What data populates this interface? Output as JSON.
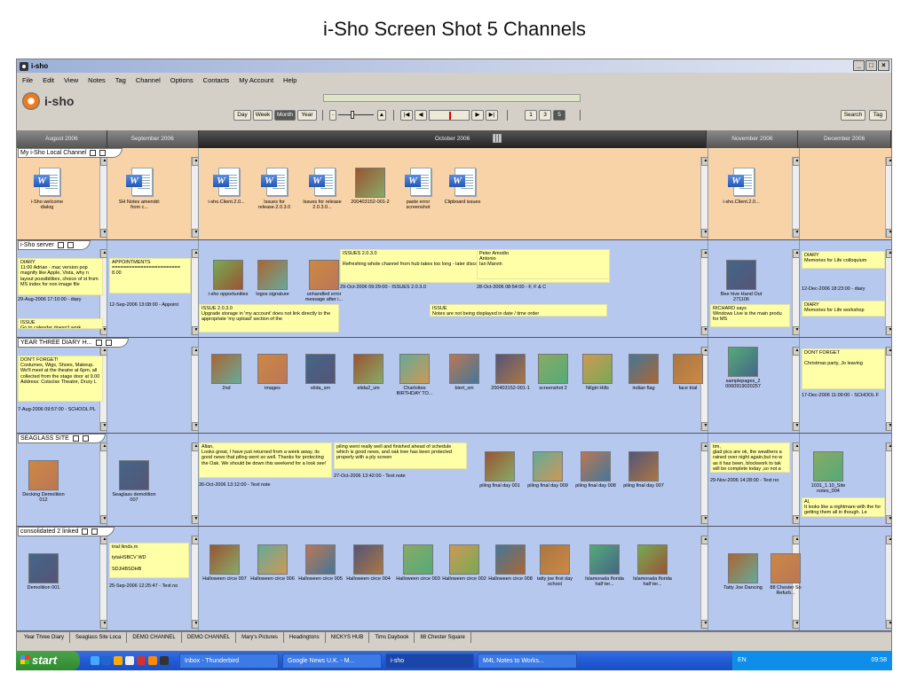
{
  "slide_title": "i-Sho Screen Shot 5 Channels",
  "window": {
    "title": "i-sho",
    "buttons": [
      "_",
      " ",
      "X"
    ]
  },
  "menu": [
    "File",
    "Edit",
    "View",
    "Notes",
    "Tag",
    "Channel",
    "Options",
    "Contacts",
    "My Account",
    "Help"
  ],
  "logo": "i-sho",
  "toolbar": {
    "views": [
      "Day",
      "Week",
      "Month",
      "Year"
    ],
    "nav": [
      "|◀",
      "◀",
      "▶",
      "▶|"
    ],
    "counts": [
      "1",
      "3",
      "5"
    ],
    "search": "Search",
    "tag": "Tag"
  },
  "months": [
    "August 2006",
    "September 2006",
    "October 2006",
    "November 2006",
    "December 2006"
  ],
  "channels": [
    {
      "name": "My i-Sho Local Channel",
      "items": [
        {
          "label": "i-Sho welcome dialog",
          "col": 0,
          "kind": "doc"
        },
        {
          "label": "SH Notes amendd: from c...",
          "col": 1,
          "kind": "doc"
        },
        {
          "label": "i-sho.Client.2.0...",
          "col": 2,
          "kind": "txt"
        },
        {
          "label": "Issues for release.2.0.3.0",
          "col": 2,
          "kind": "doc"
        },
        {
          "label": "Issues for release 2.0.3.0...",
          "col": 2,
          "kind": "doc"
        },
        {
          "label": "200403152-001-2",
          "col": 2,
          "kind": "photo"
        },
        {
          "label": "paste error screenshot",
          "col": 2,
          "kind": "doc"
        },
        {
          "label": "Clipboard issues",
          "col": 2,
          "kind": "doc"
        },
        {
          "label": "i-sho.Client.2.0...",
          "col": 3,
          "kind": "txt"
        }
      ]
    },
    {
      "name": "i-Sho server",
      "notes": [
        {
          "text": "DIARY\n11:00 Adrian - mac version pop magnify like Apple, Vista, why n layout possibilities, choice of st from MS index for non image file",
          "meta": "29-Aug-2006 17:10:00 - diary"
        },
        {
          "text": "ISSUE\nGo to calendar doesn't work",
          "meta": ""
        },
        {
          "text": "APPOINTMENTS\n========================\n8.00",
          "meta": "12-Sep-2006 13:08:00 - Appoint"
        },
        {
          "text": "ISSUES 2.0.3.0\n\nRefreshing whole channel from hub takes too long - later discovered this could be due to compress files not being set",
          "meta": "29-Oct-2006 09:29:00 - ISSUES 2.0.3.0"
        },
        {
          "text": "Peter Amodio\nAntonio\nIan Marvin",
          "meta": "28-Oct-2006 08:54:00 - F, F & C"
        },
        {
          "text": "ISSUE 2.0.3.0\nUpgrade storage in 'my account' does not link directly to the appropriate 'my upload' section of the",
          "meta": ""
        },
        {
          "text": "ISSUE\nNotes are not being displayed in date / time order",
          "meta": ""
        },
        {
          "text": "RICHARD says\nWindows Live is the main produ for MS",
          "meta": ""
        },
        {
          "text": "DIARY\nMemories for Life colloquium",
          "meta": "12-Dec-2006 18:23:00 - diary"
        },
        {
          "text": "DIARY\nMemories for Life workshop",
          "meta": ""
        }
      ],
      "items": [
        {
          "label": "i-sho opportunities"
        },
        {
          "label": "logos signature"
        },
        {
          "label": "unhandled error message after i..."
        },
        {
          "label": "Bee hive Hand Out 271106"
        }
      ]
    },
    {
      "name": "YEAR THREE DIARY H...",
      "notes": [
        {
          "text": "DON'T FORGET!\nCostumes, Wigs, Shoes, Makeup. We'll meet at the theatre at 6pm, all collected from the stage door at 9.00 Address: Cotsclse Theatre, Drury L",
          "meta": "7-Aug-2006 09:57:00 - SCHOOL PL"
        },
        {
          "text": "DONT FORGET\n\nChristmas party, Jo leaving",
          "meta": "17-Dec-2006 11:09:00 - SCHOOL F"
        }
      ],
      "items": [
        {
          "label": "2nd"
        },
        {
          "label": "images"
        },
        {
          "label": "elida_sm"
        },
        {
          "label": "elida2_sm"
        },
        {
          "label": "Charlottes BIRTHDAY TO..."
        },
        {
          "label": "blert_sm"
        },
        {
          "label": "200403152-001-1"
        },
        {
          "label": "screenshot 2"
        },
        {
          "label": "Nilgiri Hills"
        },
        {
          "label": "indian flag"
        },
        {
          "label": "face trial"
        },
        {
          "label": "samplepages_2 0060919020257"
        }
      ]
    },
    {
      "name": "SEAGLASS SITE",
      "notes": [
        {
          "text": "Allan,\nLooks great, I have just returned from a week away, its good news that piling went so well. Thanks for protecting the Oak. We should be down this weekend for a look see!",
          "meta": "30-Oct-2006 13:12:00 - Text note"
        },
        {
          "text": "piling went really well and finished ahead of schedule which is good news, and oak tree has been protected properly with a ply screen",
          "meta": "27-Oct-2006 13:42:00 - Text note"
        },
        {
          "text": "tim,\nglad pics are ok, the weathers a rained over night again,but no w as it has been, blockwork to tak will be complete today ,so not a",
          "meta": "29-Nov-2006 14:28:00 - Text no"
        },
        {
          "text": "Al,\nIt looks like a nightmare with the for getting them all in though. Le",
          "meta": ""
        }
      ],
      "items": [
        {
          "label": "Decking Demolition 012"
        },
        {
          "label": "Seaglass demolition 007"
        },
        {
          "label": "piling final day 001"
        },
        {
          "label": "piling final day 009"
        },
        {
          "label": "piling final day 008"
        },
        {
          "label": "piling final day 007"
        },
        {
          "label": "1031_1.10_Site notes_004"
        }
      ]
    },
    {
      "name": "consolidated 2 linked",
      "notes": [
        {
          "text": "trial lknds,m\n\ntytaHSBCV WD\n\nSDJHBSDHB",
          "meta": "25-Sep-2006 12:25:47 - Text no"
        }
      ],
      "items": [
        {
          "label": "Demolition 001"
        },
        {
          "label": "Halloween circe 007"
        },
        {
          "label": "Halloween circe 006"
        },
        {
          "label": "Halloween circe 005"
        },
        {
          "label": "Halloween circe 004"
        },
        {
          "label": "Halloween circe 003"
        },
        {
          "label": "Halloween circe 002"
        },
        {
          "label": "Halloween circe 008"
        },
        {
          "label": "tatty joe first day school"
        },
        {
          "label": "Islamorada florida half ter..."
        },
        {
          "label": "Islamorada florida half ter..."
        },
        {
          "label": "Tatty Joe Dancing"
        },
        {
          "label": "88 Chester So Refurb..."
        }
      ]
    }
  ],
  "bottom_tabs": [
    "Year Three Diary",
    "Seaglass Site Loca",
    "DEMO CHANNEL",
    "DEMO CHANNEL",
    "Mary's Pictures",
    "Headingtons",
    "NICKYS HUB",
    "Tims Daybook",
    "88 Chester Square"
  ],
  "taskbar": {
    "start": "start",
    "tasks": [
      "Inbox - Thunderbird",
      "Google News U.K. - M...",
      "i-sho",
      "M4L Notes to Works..."
    ],
    "lang": "EN",
    "time": "09:58"
  },
  "colors": {
    "ch1": "#f9d3a8",
    "ch2": "#b6c8ee",
    "ch3": "#b6c8ee",
    "ch4": "#b6c8ee",
    "ch5": "#b6c8ee"
  }
}
